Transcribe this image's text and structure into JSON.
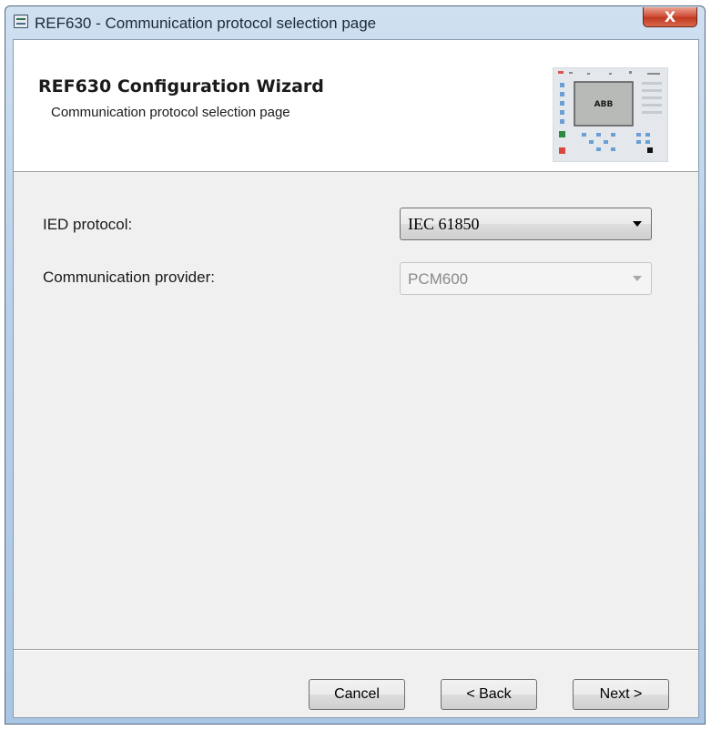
{
  "window": {
    "title": "REF630 - Communication protocol selection page",
    "close_label": "X"
  },
  "header": {
    "title": "REF630 Configuration Wizard",
    "subtitle": "Communication protocol selection page",
    "device_image_text": "ABB"
  },
  "form": {
    "ied_protocol_label": "IED protocol:",
    "ied_protocol_value": "IEC 61850",
    "provider_label": "Communication provider:",
    "provider_value": "PCM600"
  },
  "buttons": {
    "cancel": "Cancel",
    "back": "< Back",
    "next": "Next >"
  },
  "colors": {
    "accent_red": "#c13a22",
    "panel_bg": "#f0f0f0",
    "header_bg": "#ffffff"
  }
}
